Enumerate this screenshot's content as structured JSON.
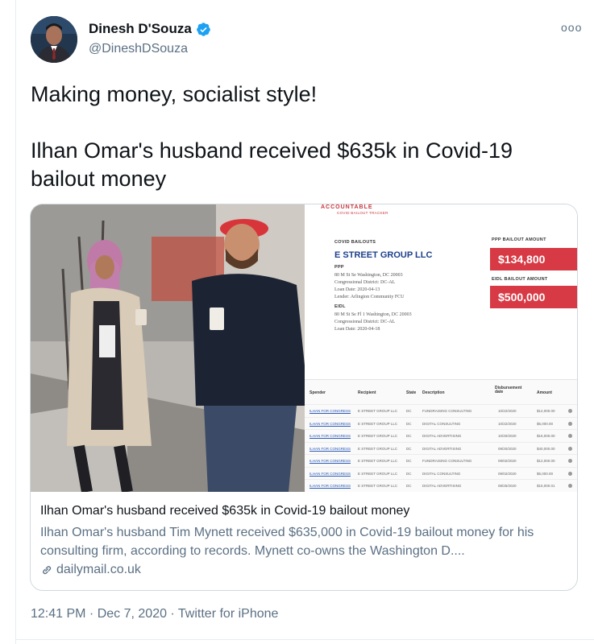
{
  "author": {
    "display_name": "Dinesh D'Souza",
    "handle": "@DineshDSouza",
    "verified": true,
    "avatar_icon": "profile-photo"
  },
  "more_label": "ooo",
  "tweet": {
    "line1": "Making money, socialist style!",
    "line2": "Ilhan Omar's husband received $635k in Covid-19 bailout money"
  },
  "card": {
    "title": "Ilhan Omar's husband received $635k in Covid-19 bailout money",
    "description": "Ilhan Omar's husband Tim Mynett received $635,000 in Covid-19 bailout money for his consulting firm, according to records. Mynett co-owns the Washington D....",
    "domain": "dailymail.co.uk",
    "link_icon": "link-icon",
    "document": {
      "brand": "ACCOUNTABLE",
      "brand_sub": "COVID BAILOUT TRACKER",
      "section_label": "COVID BAILOUTS",
      "company": "E STREET GROUP LLC",
      "ppp_label": "PPP",
      "ppp_address": "80 M St Se Washington, DC 20003",
      "ppp_district": "Congressional District: DC-AL",
      "ppp_loan_date": "Loan Date: 2020-04-13",
      "ppp_lender": "Lender: Arlington Community FCU",
      "eidl_label": "EIDL",
      "eidl_address": "80 M St Se Fl 1 Washington, DC 20003",
      "eidl_district": "Congressional District: DC-AL",
      "eidl_loan_date": "Loan Date: 2020-04-18",
      "ppp_amount_label": "PPP BAILOUT AMOUNT",
      "ppp_amount": "$134,800",
      "eidl_amount_label": "EIDL BAILOUT AMOUNT",
      "eidl_amount": "$500,000",
      "table_headers": [
        "Spender",
        "Recipient",
        "State",
        "Description",
        "Disbursement date",
        "Amount"
      ],
      "rows": [
        [
          "ILHAN FOR CONGRESS",
          "E STREET GROUP LLC",
          "DC",
          "FUNDRAISING CONSULTING",
          "10/22/2020",
          "$12,000.00"
        ],
        [
          "ILHAN FOR CONGRESS",
          "E STREET GROUP LLC",
          "DC",
          "DIGITAL CONSULTING",
          "10/22/2020",
          "$5,000.00"
        ],
        [
          "ILHAN FOR CONGRESS",
          "E STREET GROUP LLC",
          "DC",
          "DIGITAL ADVERTISING",
          "10/20/2020",
          "$16,000.00"
        ],
        [
          "ILHAN FOR CONGRESS",
          "E STREET GROUP LLC",
          "DC",
          "DIGITAL ADVERTISING",
          "09/20/2020",
          "$40,000.00"
        ],
        [
          "ILHAN FOR CONGRESS",
          "E STREET GROUP LLC",
          "DC",
          "FUNDRAISING CONSULTING",
          "09/02/2020",
          "$12,000.00"
        ],
        [
          "ILHAN FOR CONGRESS",
          "E STREET GROUP LLC",
          "DC",
          "DIGITAL CONSULTING",
          "09/02/2020",
          "$5,000.00"
        ],
        [
          "ILHAN FOR CONGRESS",
          "E STREET GROUP LLC",
          "DC",
          "DIGITAL ADVERTISING",
          "08/25/2020",
          "$15,000.01"
        ]
      ]
    }
  },
  "timestamp": "12:41 PM · Dec 7, 2020 · Twitter for iPhone",
  "colors": {
    "verified_blue": "#1da1f2",
    "accent_red": "#d73a45",
    "secondary_text": "#5b7083",
    "company_blue": "#1c3f8c"
  }
}
